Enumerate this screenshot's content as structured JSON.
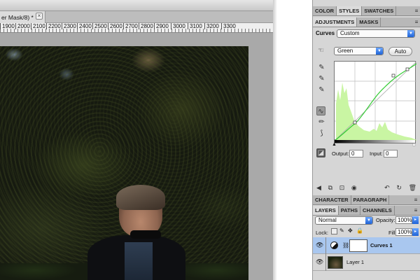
{
  "document": {
    "title": "er Mask/8) *",
    "close_symbol": "×",
    "ruler_ticks": [
      "1900",
      "2000",
      "2100",
      "2200",
      "2300",
      "2400",
      "2500",
      "2600",
      "2700",
      "2800",
      "2900",
      "3000",
      "3100",
      "3200",
      "3300"
    ]
  },
  "panel_top_tabs": [
    {
      "label": "COLOR",
      "active": false
    },
    {
      "label": "STYLES",
      "active": true
    },
    {
      "label": "SWATCHES",
      "active": false
    }
  ],
  "adjustment_tabs": [
    {
      "label": "ADJUSTMENTS",
      "active": true
    },
    {
      "label": "MASKS",
      "active": false
    }
  ],
  "curves": {
    "label": "Curves",
    "preset": "Custom",
    "channel": "Green",
    "auto_label": "Auto",
    "output_label": "Output:",
    "output_value": "0",
    "input_label": "Input:",
    "input_value": "0",
    "accent_color": "#33cc33",
    "histogram_color": "#c9f5a3"
  },
  "tools": [
    "target-adjust-icon",
    "eyedropper-black-icon",
    "eyedropper-gray-icon",
    "eyedropper-white-icon",
    "curve-point-icon",
    "pencil-icon",
    "smooth-icon",
    "clip-warning-icon"
  ],
  "adjust_footer_icons": [
    "back-arrow-icon",
    "expand-view-icon",
    "clip-layer-icon",
    "visibility-eye-icon",
    "previous-state-icon",
    "reset-icon",
    "delete-icon"
  ],
  "lower_tabs": [
    {
      "label": "CHARACTER",
      "active": false
    },
    {
      "label": "PARAGRAPH",
      "active": false
    }
  ],
  "layers_tabs": [
    {
      "label": "LAYERS",
      "active": true
    },
    {
      "label": "PATHS",
      "active": false
    },
    {
      "label": "CHANNELS",
      "active": false
    }
  ],
  "layers": {
    "blend_mode": "Normal",
    "opacity_label": "Opacity:",
    "opacity_value": "100%",
    "lock_label": "Lock:",
    "fill_label": "Fill:",
    "fill_value": "100%",
    "items": [
      {
        "name": "Curves 1",
        "selected": true
      },
      {
        "name": "Layer 1",
        "selected": false
      }
    ]
  }
}
